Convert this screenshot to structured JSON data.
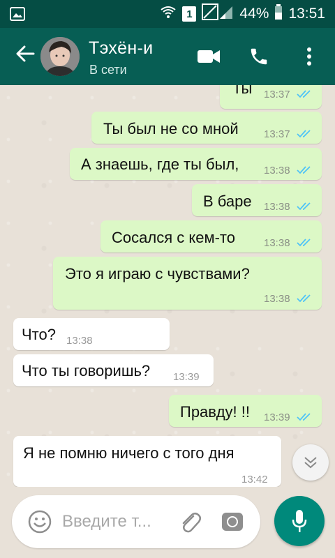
{
  "status_bar": {
    "battery": "44%",
    "time": "13:51",
    "sim_badge": "1"
  },
  "header": {
    "contact_name": "Тэхён-и",
    "contact_status": "В сети"
  },
  "messages": [
    {
      "dir": "out",
      "text": "Ты",
      "time": "13:37",
      "read": true
    },
    {
      "dir": "out",
      "text": "Ты был не со мной",
      "time": "13:37",
      "read": true
    },
    {
      "dir": "out",
      "text": "А знаешь, где ты был,",
      "time": "13:38",
      "read": true
    },
    {
      "dir": "out",
      "text": "В баре",
      "time": "13:38",
      "read": true
    },
    {
      "dir": "out",
      "text": "Сосался с кем-то",
      "time": "13:38",
      "read": true
    },
    {
      "dir": "out",
      "text": "Это я играю с чувствами?",
      "time": "13:38",
      "read": true
    },
    {
      "dir": "in",
      "text": "Что?",
      "time": "13:38"
    },
    {
      "dir": "in",
      "text": "Что ты говоришь?",
      "time": "13:39"
    },
    {
      "dir": "out",
      "text": "Правду! !!",
      "time": "13:39",
      "read": true
    },
    {
      "dir": "in",
      "text": "Я не помню ничего с того дня",
      "time": "13:42"
    }
  ],
  "composer": {
    "placeholder": "Введите т..."
  },
  "colors": {
    "header": "#075e54",
    "status_bar": "#054d44",
    "outgoing_bubble": "#dcf8c6",
    "incoming_bubble": "#ffffff",
    "read_ticks": "#4fc3f7",
    "mic_button": "#00897b"
  }
}
